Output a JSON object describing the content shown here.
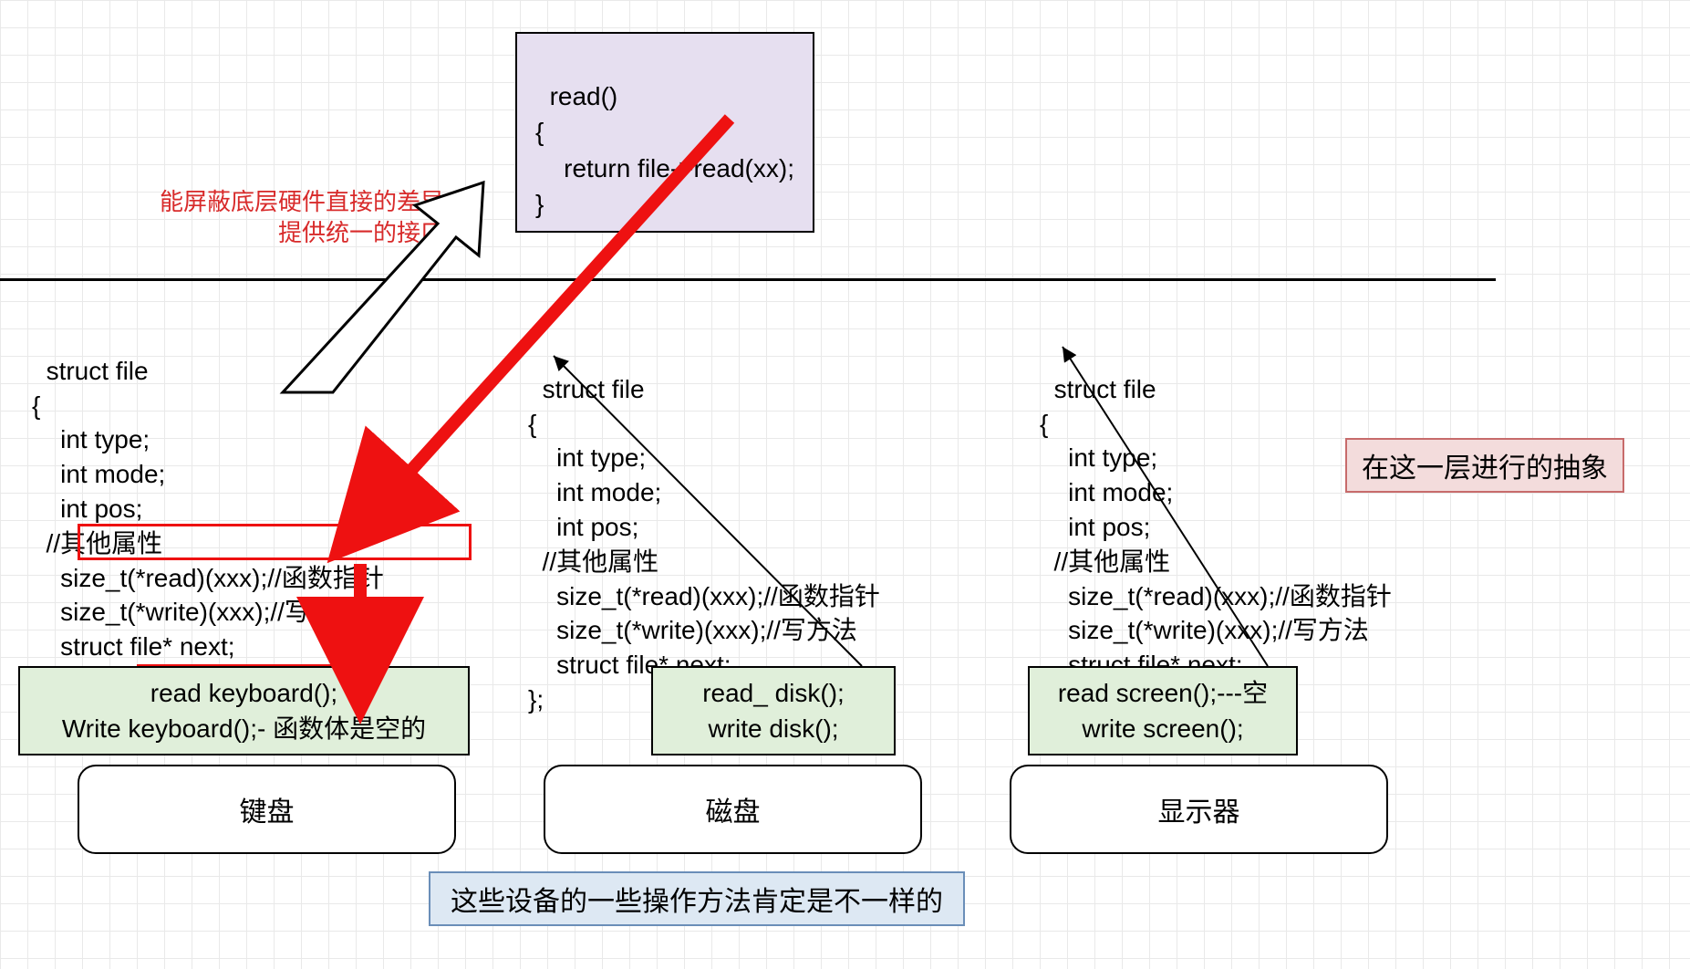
{
  "top": {
    "read_code": "read()\n{\n    return file->read(xx);\n}",
    "annotation_line1": "能屏蔽底层硬件直接的差异",
    "annotation_line2": "提供统一的接口"
  },
  "right_note": "在这一层进行的抽象",
  "struct_code": "struct file\n{\n    int type;\n    int mode;\n    int pos;\n  //其他属性\n    size_t(*read)(xxx);//函数指针\n    size_t(*write)(xxx);//写方法\n    struct file* next;\n};",
  "devices": {
    "keyboard": {
      "read": "read keyboard();",
      "write": "Write keyboard();- 函数体是空的",
      "label": "键盘"
    },
    "disk": {
      "read": "read_ disk();",
      "write": "write disk();",
      "label": "磁盘"
    },
    "screen": {
      "read": "read screen();---空",
      "write": "write screen();",
      "label": "显示器"
    }
  },
  "bottom_note": "这些设备的一些操作方法肯定是不一样的"
}
